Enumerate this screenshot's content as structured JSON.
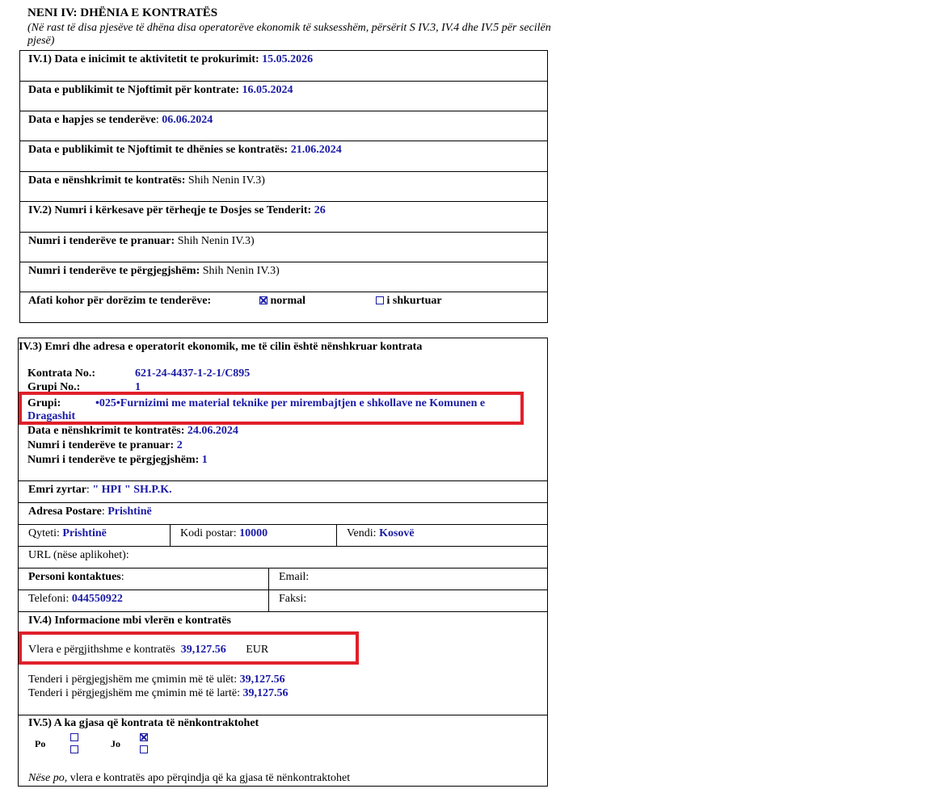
{
  "header": {
    "title": "NENI IV: DHËNIA E KONTRATËS",
    "note": "(Në rast të disa pjesëve të dhëna disa operatorëve ekonomik të suksesshëm, përsërit S IV.3, IV.4 dhe IV.5 për secilën pjesë)"
  },
  "s1": {
    "r1_label": "IV.1) Data e inicimit te aktivitetit te prokurimit:",
    "r1_value": "15.05.2026",
    "r2_label": "Data e publikimit te Njoftimit për kontrate:",
    "r2_value": "16.05.2024",
    "r3_label": "Data e hapjes se tenderëve",
    "r3_colon": ":",
    "r3_value": "06.06.2024",
    "r4_label": "Data e publikimit te Njoftimit te dhënies se kontratës:",
    "r4_value": "21.06.2024",
    "r5_label": "Data e nënshkrimit te kontratës:",
    "r5_value": "Shih Nenin IV.3)",
    "r6_label": "IV.2) Numri i kërkesave për tërheqje te Dosjes se Tenderit:",
    "r6_value": "26",
    "r7_label": "Numri i tenderëve te pranuar:",
    "r7_value": "Shih Nenin IV.3)",
    "r8_label": "Numri i tenderëve te përgjegjshëm:",
    "r8_value": "Shih Nenin IV.3)",
    "r9_label": "Afati kohor për dorëzim te tenderëve:",
    "r9_opt1": "normal",
    "r9_opt2": "i shkurtuar"
  },
  "s3": {
    "heading": "IV.3) Emri dhe adresa e operatorit ekonomik, me të cilin është nënshkruar kontrata",
    "contract_label": "Kontrata No.:",
    "contract_value": "621-24-4437-1-2-1/C895",
    "group_no_label": "Grupi No.:",
    "group_no_value": "1",
    "group_label": "Grupi:",
    "group_value_1": "•025•Furnizimi me  material teknike per mirembajtjen e shkollave ne Komunen e",
    "group_value_2": "Dragashit",
    "sign_date_label": "Data e nënshkrimit te kontratës:",
    "sign_date_value": "24.06.2024",
    "accepted_label": "Numri i tenderëve te pranuar:",
    "accepted_value": "2",
    "responsive_label": "Numri i tenderëve te përgjegjshëm:",
    "responsive_value": "1",
    "name_label": "Emri zyrtar",
    "name_colon": ":",
    "name_value": "\" HPI \" SH.P.K.",
    "address_label": "Adresa Postare",
    "address_colon": ":",
    "address_value": "Prishtinë",
    "city_label": "Qyteti:",
    "city_value": "Prishtinë",
    "postal_label": "Kodi postar:",
    "postal_value": "10000",
    "country_label": "Vendi:",
    "country_value": "Kosovë",
    "url_label": "URL (nëse aplikohet):",
    "contact_label": "Personi kontaktues",
    "contact_colon": ":",
    "email_label": "Email:",
    "phone_label": "Telefoni:",
    "phone_value": "044550922",
    "fax_label": "Faksi:"
  },
  "s4": {
    "heading": "IV.4) Informacione mbi vlerën e kontratës",
    "total_label": "Vlera e përgjithshme e kontratës",
    "total_value": "39,127.56",
    "currency": "EUR",
    "lowest_label": "Tenderi i përgjegjshëm me çmimin më të ulët:",
    "lowest_value": "39,127.56",
    "highest_label": "Tenderi i përgjegjshëm me çmimin më të lartë:",
    "highest_value": "39,127.56"
  },
  "s5": {
    "heading": "IV.5) A ka gjasa që kontrata të nënkontraktohet",
    "yes_label": "Po",
    "no_label": "Jo",
    "footer_italic": "Nëse po,",
    "footer_rest": " vlera e kontratës apo përqindja që ka gjasa të nënkontraktohet"
  },
  "colors": {
    "value_blue": "#1a1aa6",
    "highlight_red": "#e0202a"
  }
}
